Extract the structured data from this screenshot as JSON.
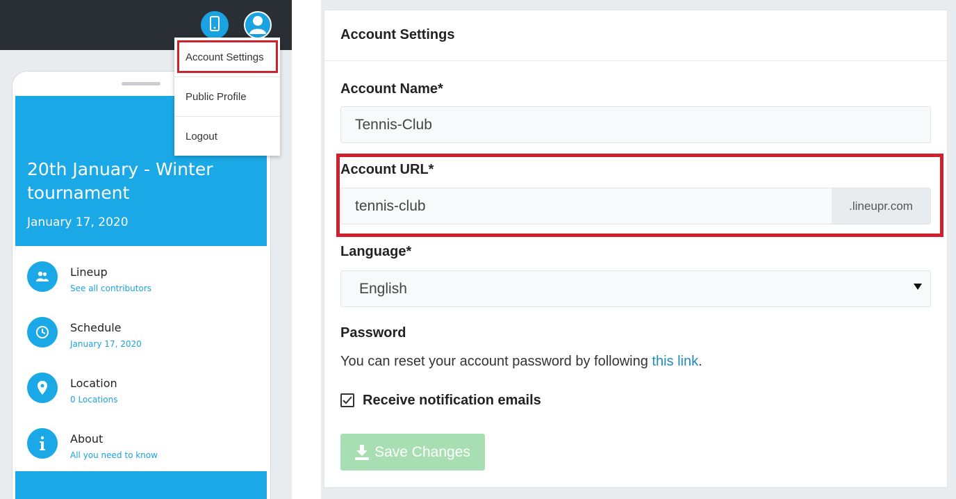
{
  "dropdown": {
    "items": [
      "Account Settings",
      "Public Profile",
      "Logout"
    ]
  },
  "event": {
    "title": "20th January - Winter tournament",
    "date": "January 17, 2020",
    "menu": [
      {
        "title": "Lineup",
        "subtitle": "See all contributors",
        "icon": "users-icon"
      },
      {
        "title": "Schedule",
        "subtitle": "January 17, 2020",
        "icon": "clock-icon"
      },
      {
        "title": "Location",
        "subtitle": "0 Locations",
        "icon": "map-pin-icon"
      },
      {
        "title": "About",
        "subtitle": "All you need to know",
        "icon": "info-icon"
      }
    ]
  },
  "settings": {
    "title": "Account Settings",
    "account_name_label": "Account Name*",
    "account_name_value": "Tennis-Club",
    "account_url_label": "Account URL*",
    "account_url_value": "tennis-club",
    "account_url_suffix": ".lineupr.com",
    "language_label": "Language*",
    "language_value": "English",
    "password_label": "Password",
    "password_text": "You can reset your account password by following ",
    "password_link": "this link",
    "password_period": ".",
    "notify_label": "Receive notification emails",
    "notify_checked": true,
    "save_label": "Save Changes"
  },
  "colors": {
    "accent": "#1aa9e6",
    "highlight": "#d0202e",
    "save_disabled": "#a7dfb3",
    "topbar": "#2a2f35",
    "link": "#1f8bb8"
  }
}
